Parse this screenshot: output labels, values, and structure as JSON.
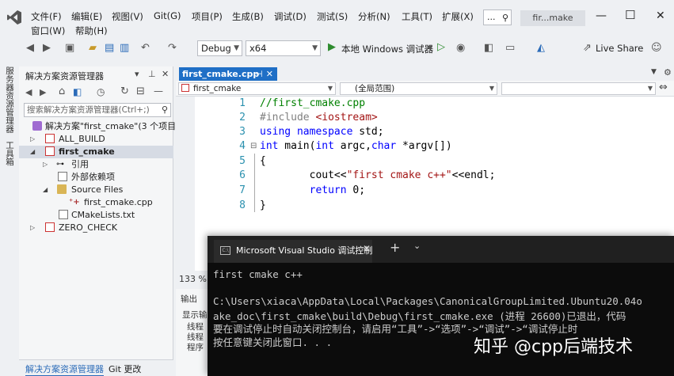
{
  "menu": {
    "items": [
      "文件(F)",
      "编辑(E)",
      "视图(V)",
      "Git(G)",
      "项目(P)",
      "生成(B)",
      "调试(D)",
      "测试(S)",
      "分析(N)",
      "工具(T)",
      "扩展(X)"
    ],
    "row2": [
      "窗口(W)",
      "帮助(H)"
    ],
    "search": "...",
    "solution_name": "fir...make"
  },
  "toolbar": {
    "config": "Debug",
    "platform": "x64",
    "run_label": "本地 Windows 调试器",
    "live_share": "Live Share"
  },
  "left_strip": {
    "tab1": "服务器资源管理器",
    "tab2": "工具箱"
  },
  "solution_explorer": {
    "title": "解决方案资源管理器",
    "search_placeholder": "搜索解决方案资源管理器(Ctrl+;)",
    "tree": [
      {
        "label": "解决方案\"first_cmake\"(3 个项目,",
        "bold": false
      },
      {
        "label": "ALL_BUILD",
        "bold": false
      },
      {
        "label": "first_cmake",
        "bold": true
      },
      {
        "label": "引用",
        "bold": false
      },
      {
        "label": "外部依赖项",
        "bold": false
      },
      {
        "label": "Source Files",
        "bold": false
      },
      {
        "label": "first_cmake.cpp",
        "bold": false
      },
      {
        "label": "CMakeLists.txt",
        "bold": false
      },
      {
        "label": "ZERO_CHECK",
        "bold": false
      }
    ],
    "bottom_tabs": [
      "解决方案资源管理器",
      "Git 更改"
    ]
  },
  "editor": {
    "tab_label": "first_cmake.cpp",
    "nav_scope": "first_cmake",
    "nav_global": "(全局范围)",
    "zoom": "133 %",
    "line_numbers": [
      "1",
      "2",
      "3",
      "4",
      "5",
      "6",
      "7",
      "8"
    ],
    "code": {
      "l1": "//first_cmake.cpp",
      "l2_pre": "#include ",
      "l2_inc": "<iostream>",
      "l3_kw": "using namespace",
      "l3_rest": " std;",
      "l4_kw": "int",
      "l4_a": " main(",
      "l4_kw2": "int",
      "l4_b": " argc,",
      "l4_kw3": "char",
      "l4_c": " *argv[])",
      "l5": "{",
      "l6_a": "        cout<<",
      "l6_str": "\"first cmake c++\"",
      "l6_b": "<<endl;",
      "l7_kw": "        return",
      "l7_rest": " 0;",
      "l8": "}"
    }
  },
  "output_pane": {
    "title": "输出",
    "show_label": "显示输",
    "rows": [
      "线程",
      "线程",
      "程序"
    ]
  },
  "console": {
    "tab_title": "Microsoft Visual Studio 调试控制",
    "lines": [
      "first cmake c++",
      "",
      "C:\\Users\\xiaca\\AppData\\Local\\Packages\\CanonicalGroupLimited.Ubuntu20.04o",
      "ake_doc\\first_cmake\\build\\Debug\\first_cmake.exe (进程 26600)已退出，代码",
      "要在调试停止时自动关闭控制台，请启用“工具”->“选项”->“调试”->“调试停止时",
      "按任意键关闭此窗口. . ."
    ],
    "watermark": "知乎 @cpp后端技术"
  }
}
